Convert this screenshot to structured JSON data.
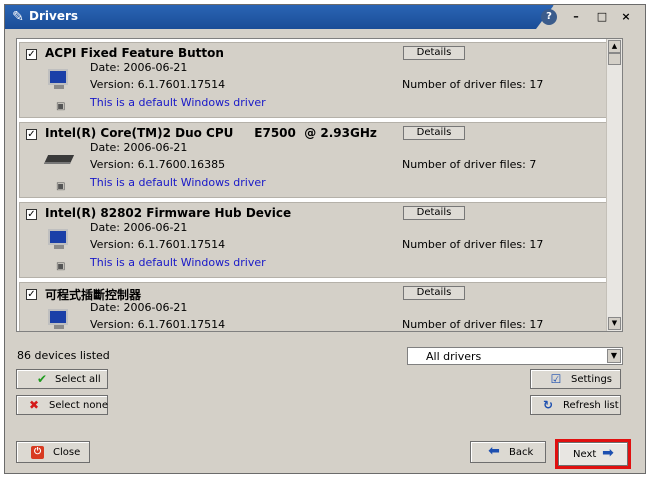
{
  "window": {
    "title": "Drivers"
  },
  "titlebar": {
    "help_glyph": "?",
    "minimize": "–",
    "maximize": "□",
    "close": "×"
  },
  "drivers": [
    {
      "name": "ACPI Fixed Feature Button",
      "date": "Date: 2006-06-21",
      "version": "Version: 6.1.7601.17514",
      "default": "This is a default Windows driver",
      "files": "Number of driver files: 17",
      "details": "Details",
      "icon": "monitor-icon"
    },
    {
      "name": "Intel(R) Core(TM)2 Duo CPU     E7500  @ 2.93GHz",
      "date": "Date: 2006-06-21",
      "version": "Version: 6.1.7600.16385",
      "default": "This is a default Windows driver",
      "files": "Number of driver files: 7",
      "details": "Details",
      "icon": "processor-icon"
    },
    {
      "name": "Intel(R) 82802 Firmware Hub Device",
      "date": "Date: 2006-06-21",
      "version": "Version: 6.1.7601.17514",
      "default": "This is a default Windows driver",
      "files": "Number of driver files: 17",
      "details": "Details",
      "icon": "monitor-icon"
    },
    {
      "name": "可程式插斷控制器",
      "date": "Date: 2006-06-21",
      "version": "Version: 6.1.7601.17514",
      "default": "",
      "files": "Number of driver files: 17",
      "details": "Details",
      "icon": "monitor-icon"
    }
  ],
  "footer": {
    "count_label": "86 devices listed",
    "filter_selected": "All drivers",
    "select_all": "Select all",
    "select_none": "Select none",
    "settings": "Settings",
    "refresh": "Refresh list",
    "close": "Close",
    "back": "Back",
    "next": "Next"
  },
  "colors": {
    "titlebar": "#1f56a4",
    "link_text": "#1818c8",
    "highlight": "#e01010"
  }
}
